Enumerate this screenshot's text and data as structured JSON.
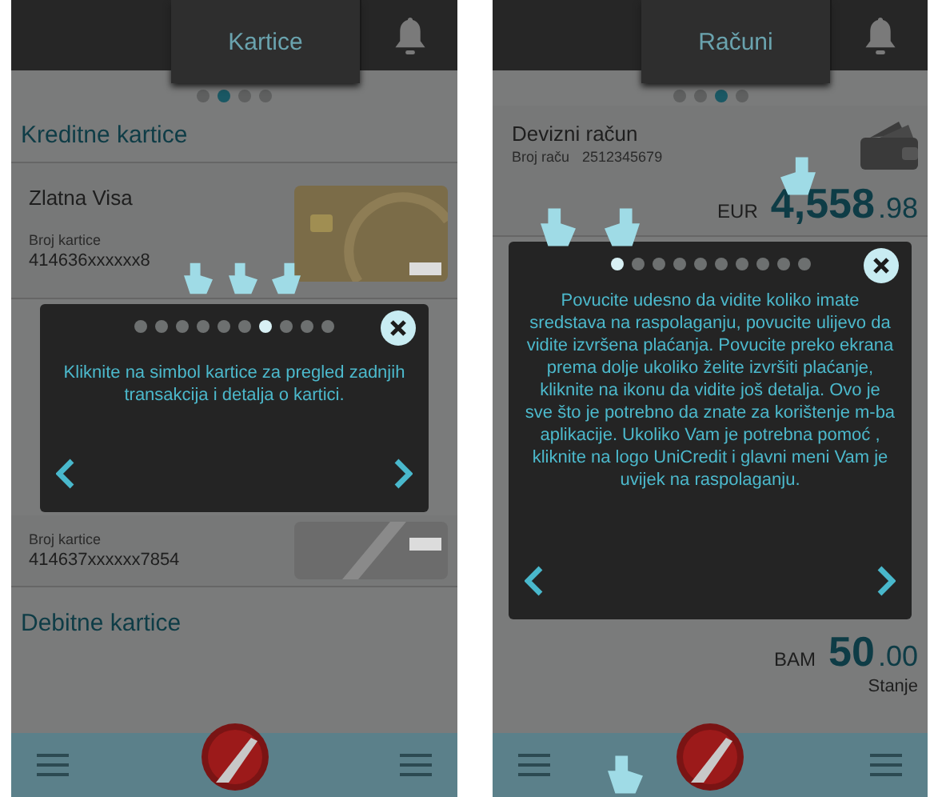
{
  "screens": [
    {
      "kind": "cards",
      "title": "Kartice",
      "page_dots": [
        {
          "selected": false
        },
        {
          "selected": true
        },
        {
          "selected": false
        },
        {
          "selected": false
        }
      ],
      "section": "Kreditne kartice",
      "cards_above": [
        {
          "name": "Zlatna Visa",
          "number_label": "Broj kartice",
          "number": "414636xxxxxx8"
        }
      ],
      "tutorial": {
        "dots": [
          {
            "selected": false
          },
          {
            "selected": false
          },
          {
            "selected": false
          },
          {
            "selected": false
          },
          {
            "selected": false
          },
          {
            "selected": false
          },
          {
            "selected": true
          },
          {
            "selected": false
          },
          {
            "selected": false
          },
          {
            "selected": false
          }
        ],
        "text": "Kliknite na simbol kartice za pregled zadnjih transakcija i detalja o kartici."
      },
      "cards_below": [
        {
          "number_label": "Broj kartice",
          "number": "414637xxxxxx7854"
        }
      ],
      "footer_section": "Debitne kartice"
    },
    {
      "kind": "accounts",
      "title": "Računi",
      "page_dots": [
        {
          "selected": false
        },
        {
          "selected": false
        },
        {
          "selected": true
        },
        {
          "selected": false
        }
      ],
      "accounts_above": [
        {
          "name": "Devizni račun",
          "number_label": "Broj raču",
          "number": "2512345679",
          "currency": "EUR",
          "amount": "4,558",
          "decimals": ".98"
        }
      ],
      "tutorial": {
        "dots": [
          {
            "selected": true
          },
          {
            "selected": false
          },
          {
            "selected": false
          },
          {
            "selected": false
          },
          {
            "selected": false
          },
          {
            "selected": false
          },
          {
            "selected": false
          },
          {
            "selected": false
          },
          {
            "selected": false
          },
          {
            "selected": false
          }
        ],
        "text": "Povucite udesno da vidite koliko imate sredstava na raspolaganju, povucite ulijevo da vidite izvršena plaćanja. Povucite preko ekrana prema dolje ukoliko želite izvršiti plaćanje, kliknite na ikonu da vidite još detalja. Ovo je sve što je potrebno da znate za korištenje m-ba aplikacije. Ukoliko Vam je potrebna pomoć , kliknite na logo UniCredit i glavni meni Vam je uvijek na raspolaganju."
      },
      "accounts_below": [
        {
          "currency": "BAM",
          "amount": "50",
          "decimals": ".00",
          "balance_label": "Stanje"
        }
      ]
    }
  ]
}
